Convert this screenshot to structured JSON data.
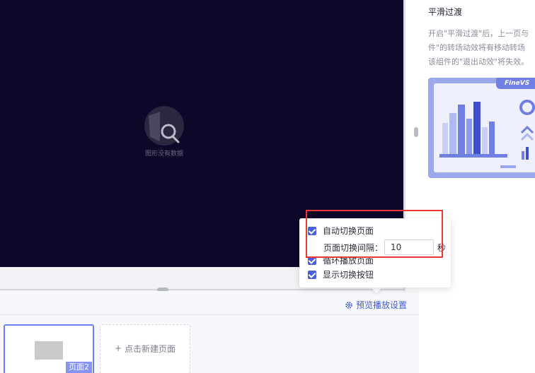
{
  "canvas": {
    "empty_text": "图形没有数据"
  },
  "right_panel": {
    "title": "平滑过渡",
    "description_lines": [
      "开启\"平滑过渡\"后，上一页与",
      "件\"的转场动效将有移动转场",
      "该组件的\"退出动效\"将失效。"
    ],
    "preview_tag": "FineVS"
  },
  "popover": {
    "auto_switch_label": "自动切换页面",
    "auto_switch_checked": true,
    "interval_label": "页面切换间隔：",
    "interval_value": "10",
    "interval_unit": "秒",
    "loop_label": "循环播放页面",
    "loop_checked": true,
    "show_buttons_label": "显示切换按钮",
    "show_buttons_checked": true
  },
  "bottom": {
    "preview_settings_label": "预览播放设置",
    "page_label": "页面2",
    "new_page_label": "点击新建页面"
  },
  "colors": {
    "accent": "#4a5fe0",
    "canvas_bg": "#0d0829",
    "highlight": "#e83a3a"
  }
}
